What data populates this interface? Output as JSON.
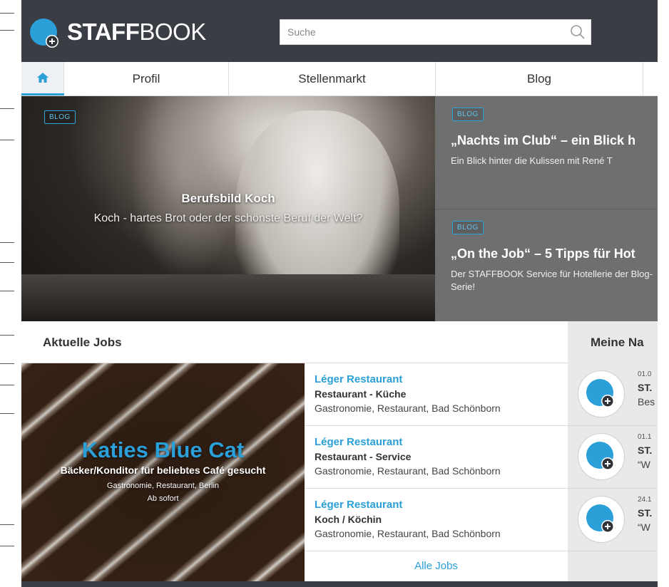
{
  "colors": {
    "accent": "#2a9fd8",
    "topbar": "#3a3d43",
    "card_bg": "#6f6f6f"
  },
  "header": {
    "logo_icon": "staffbook-logo-icon",
    "brand_bold": "STAFF",
    "brand_light": "BOOK",
    "search": {
      "placeholder": "Suche",
      "value": "",
      "icon": "search-icon"
    }
  },
  "nav": {
    "home_icon": "home-icon",
    "tabs": [
      {
        "label": "Profil"
      },
      {
        "label": "Stellenmarkt"
      },
      {
        "label": "Blog"
      },
      {
        "label": ""
      }
    ]
  },
  "hero": {
    "tag": "BLOG",
    "title": "Berufsbild Koch",
    "subtitle": "Koch - hartes Brot oder der schönste Beruf der Welt?"
  },
  "blog_cards": [
    {
      "tag": "BLOG",
      "title": "„Nachts im Club“ – ein Blick h",
      "text": "Ein Blick hinter die Kulissen mit René T"
    },
    {
      "tag": "BLOG",
      "title": "„On the Job“ – 5 Tipps für Hot",
      "text": "Der STAFFBOOK Service für Hotellerie der Blog-Serie!"
    }
  ],
  "jobs": {
    "heading": "Aktuelle Jobs",
    "featured": {
      "name": "Katies Blue Cat",
      "title": "Bäcker/Konditor für beliebtes Café gesucht",
      "meta": "Gastronomie, Restaurant, Berlin",
      "start": "Ab sofort"
    },
    "list": [
      {
        "company": "Léger Restaurant",
        "title": "Restaurant - Küche",
        "meta": "Gastronomie, Restaurant, Bad Schönborn"
      },
      {
        "company": "Léger Restaurant",
        "title": "Restaurant - Service",
        "meta": "Gastronomie, Restaurant, Bad Schönborn"
      },
      {
        "company": "Léger Restaurant",
        "title": "Koch / Köchin",
        "meta": "Gastronomie, Restaurant, Bad Schönborn"
      }
    ],
    "all_jobs_label": "Alle Jobs"
  },
  "news": {
    "heading": "Meine Na",
    "items": [
      {
        "date": "01.0",
        "source": "ST.",
        "text": "Bes"
      },
      {
        "date": "01.1",
        "source": "ST.",
        "text": "“W"
      },
      {
        "date": "24.1",
        "source": "ST.",
        "text": "“W"
      }
    ]
  }
}
